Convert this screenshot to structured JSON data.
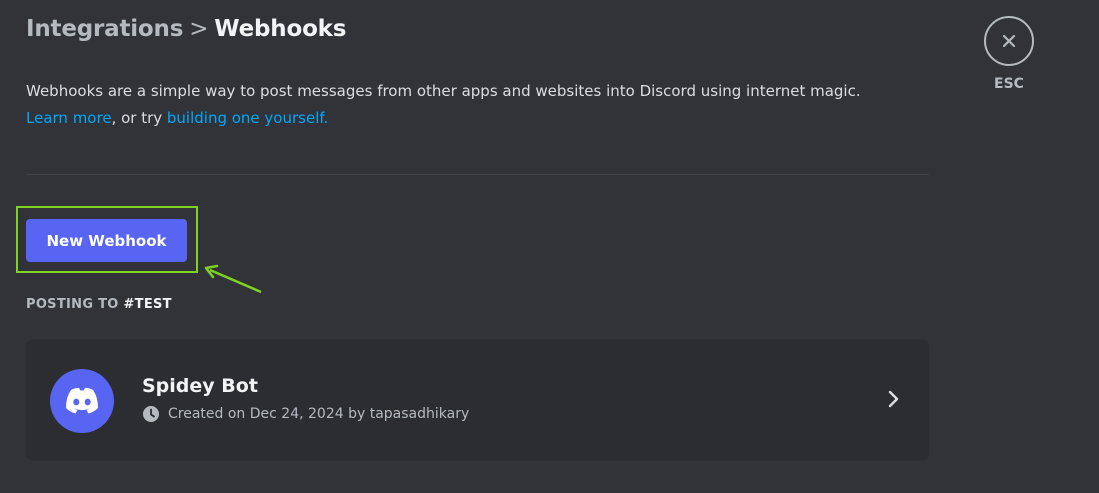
{
  "breadcrumb": {
    "parent": "Integrations",
    "separator": ">",
    "current": "Webhooks"
  },
  "description": {
    "text": "Webhooks are a simple way to post messages from other apps and websites into Discord using internet magic.",
    "learn_more": "Learn more",
    "or_try": ", or try ",
    "build_link": "building one yourself."
  },
  "new_webhook_button": "New Webhook",
  "section": {
    "prefix": "POSTING TO ",
    "channel": "#TEST"
  },
  "webhooks": [
    {
      "name": "Spidey Bot",
      "created": "Created on Dec 24, 2024 by tapasadhikary",
      "avatar_icon": "discord-logo-icon"
    }
  ],
  "close": {
    "label": "ESC",
    "icon": "close-icon"
  },
  "colors": {
    "background": "#313338",
    "accent": "#5865f2",
    "link": "#00a8fc",
    "highlight": "#7ed321",
    "card": "#2b2d31"
  }
}
